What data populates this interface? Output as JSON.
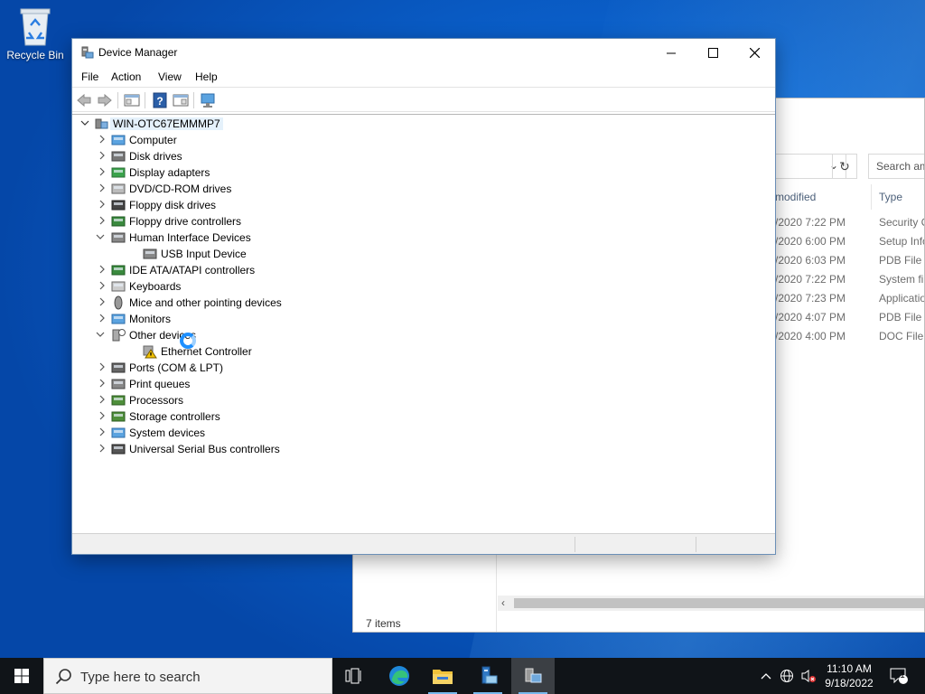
{
  "desktop": {
    "recycle_bin_label": "Recycle Bin"
  },
  "explorer": {
    "search_placeholder": "Search am",
    "col_modified": "modified",
    "col_type": "Type",
    "rows": [
      {
        "date": "/2020 7:22 PM",
        "type": "Security C"
      },
      {
        "date": "/2020 6:00 PM",
        "type": "Setup Info"
      },
      {
        "date": "/2020 6:03 PM",
        "type": "PDB File"
      },
      {
        "date": "/2020 7:22 PM",
        "type": "System fil"
      },
      {
        "date": "/2020 7:23 PM",
        "type": "Applicatio"
      },
      {
        "date": "/2020 4:07 PM",
        "type": "PDB File"
      },
      {
        "date": "/2020 4:00 PM",
        "type": "DOC File"
      }
    ],
    "status": "7 items"
  },
  "device_manager": {
    "title": "Device Manager",
    "menu": [
      "File",
      "Action",
      "View",
      "Help"
    ],
    "root": "WIN-OTC67EMMMP7",
    "tree": [
      {
        "label": "Computer",
        "icon": "computer-icon",
        "expanded": false,
        "level": 1
      },
      {
        "label": "Disk drives",
        "icon": "disk-drive-icon",
        "expanded": false,
        "level": 1
      },
      {
        "label": "Display adapters",
        "icon": "display-adapter-icon",
        "expanded": false,
        "level": 1
      },
      {
        "label": "DVD/CD-ROM drives",
        "icon": "dvd-drive-icon",
        "expanded": false,
        "level": 1
      },
      {
        "label": "Floppy disk drives",
        "icon": "floppy-disk-icon",
        "expanded": false,
        "level": 1
      },
      {
        "label": "Floppy drive controllers",
        "icon": "floppy-controller-icon",
        "expanded": false,
        "level": 1
      },
      {
        "label": "Human Interface Devices",
        "icon": "hid-icon",
        "expanded": true,
        "level": 1
      },
      {
        "label": "USB Input Device",
        "icon": "hid-icon",
        "level": 2
      },
      {
        "label": "IDE ATA/ATAPI controllers",
        "icon": "ide-controller-icon",
        "expanded": false,
        "level": 1
      },
      {
        "label": "Keyboards",
        "icon": "keyboard-icon",
        "expanded": false,
        "level": 1
      },
      {
        "label": "Mice and other pointing devices",
        "icon": "mouse-icon",
        "expanded": false,
        "level": 1
      },
      {
        "label": "Monitors",
        "icon": "monitor-icon",
        "expanded": false,
        "level": 1
      },
      {
        "label": "Other devices",
        "icon": "unknown-device-icon",
        "expanded": true,
        "level": 1
      },
      {
        "label": "Ethernet Controller",
        "icon": "warning-device-icon",
        "level": 2
      },
      {
        "label": "Ports (COM & LPT)",
        "icon": "port-icon",
        "expanded": false,
        "level": 1
      },
      {
        "label": "Print queues",
        "icon": "printer-icon",
        "expanded": false,
        "level": 1
      },
      {
        "label": "Processors",
        "icon": "processor-icon",
        "expanded": false,
        "level": 1
      },
      {
        "label": "Storage controllers",
        "icon": "storage-controller-icon",
        "expanded": false,
        "level": 1
      },
      {
        "label": "System devices",
        "icon": "system-device-icon",
        "expanded": false,
        "level": 1
      },
      {
        "label": "Universal Serial Bus controllers",
        "icon": "usb-icon",
        "expanded": false,
        "level": 1
      }
    ]
  },
  "taskbar": {
    "search_placeholder": "Type here to search",
    "time": "11:10 AM",
    "date": "9/18/2022",
    "notification_count": "1"
  }
}
